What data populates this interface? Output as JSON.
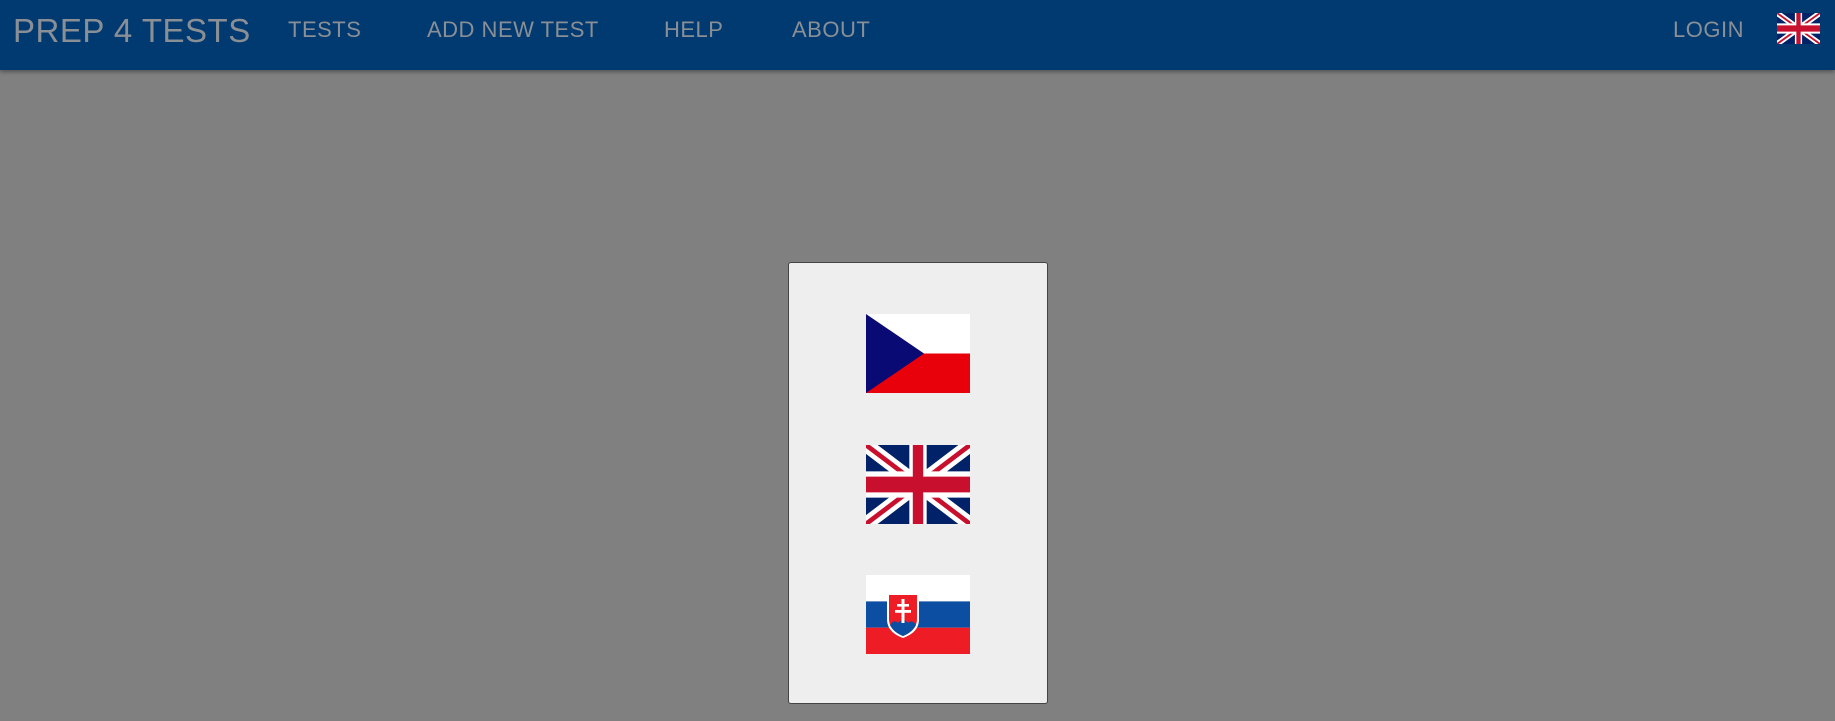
{
  "navbar": {
    "brand": "PREP 4 TESTS",
    "links": {
      "tests": "TESTS",
      "add_new_test": "ADD NEW TEST",
      "help": "HELP",
      "about": "ABOUT"
    },
    "login": "LOGIN",
    "current_language_icon": "uk-flag-icon",
    "bg_color": "#003a70",
    "text_color": "#8a8f96"
  },
  "language_dialog": {
    "options": [
      {
        "icon": "czech-flag-icon"
      },
      {
        "icon": "uk-flag-icon"
      },
      {
        "icon": "slovak-flag-icon"
      }
    ],
    "bg_color": "#eeeeee",
    "overlay_color": "#808080"
  }
}
